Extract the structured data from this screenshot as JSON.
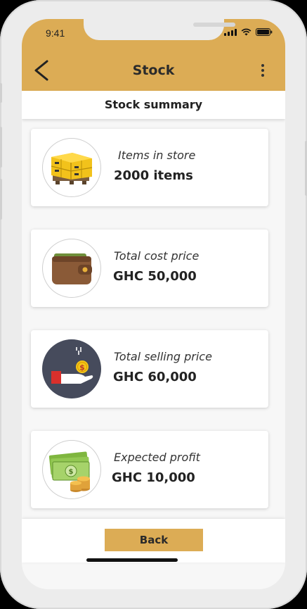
{
  "status_bar": {
    "time": "9:41"
  },
  "header": {
    "title": "Stock"
  },
  "subheader": {
    "title": "Stock summary"
  },
  "cards": [
    {
      "label": "Items in store",
      "value": "2000 items",
      "icon": "pallet-boxes-icon"
    },
    {
      "label": "Total cost price",
      "value": "GHC 50,000",
      "icon": "wallet-icon"
    },
    {
      "label": "Total selling price",
      "value": "GHC 60,000",
      "icon": "hand-coin-icon"
    },
    {
      "label": "Expected profit",
      "value": "GHC 10,000",
      "icon": "money-stack-icon"
    }
  ],
  "footer": {
    "back_label": "Back"
  },
  "colors": {
    "accent": "#dcac55",
    "background": "#f7f7f7"
  }
}
